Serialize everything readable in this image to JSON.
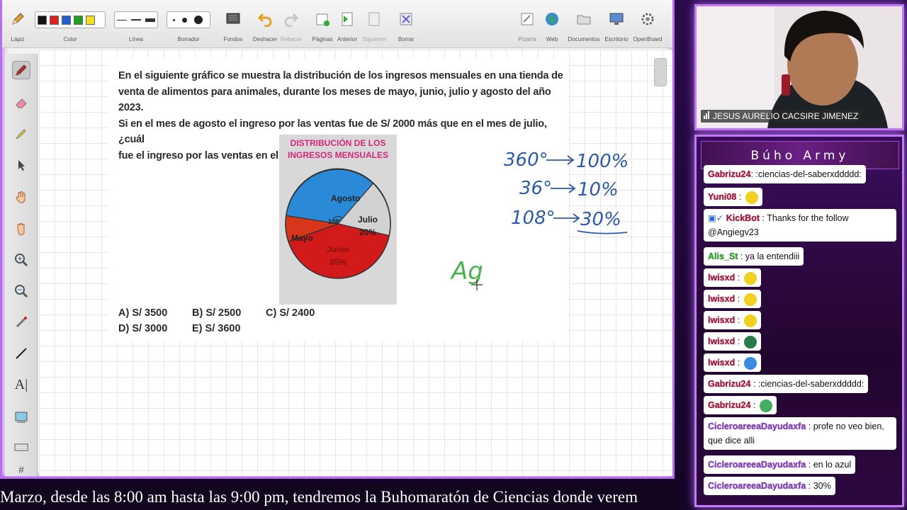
{
  "toolbar": {
    "pencil_label": "Lápiz",
    "color_label": "Color",
    "line_label": "Línea",
    "eraser_label": "Borrador",
    "backgrounds_label": "Fondos",
    "undo_label": "Deshacer",
    "redo_label": "Rehacer",
    "pages_label": "Páginas",
    "previous_label": "Anterior",
    "next_label": "Siguiente",
    "delete_label": "Borrar",
    "board_label": "Pizarra",
    "web_label": "Web",
    "documents_label": "Documentos",
    "desktop_label": "Escritorio",
    "openboard_label": "OpenBoard",
    "colors": [
      "#111111",
      "#e02020",
      "#1f5fd0",
      "#20a020",
      "#f0e020"
    ]
  },
  "left_tools": [
    "pen-icon",
    "marker-icon",
    "highlighter-icon",
    "pointer-icon",
    "hand-icon",
    "grab-icon",
    "zoom-in-icon",
    "zoom-out-icon",
    "laser-icon",
    "line-icon",
    "text-icon",
    "capture-icon",
    "keyboard-icon",
    "grid-icon"
  ],
  "problem": {
    "line1": "En el siguiente gráfico se muestra la distribución de los ingresos mensuales en una tienda de",
    "line2": "venta de alimentos para animales, durante los meses de mayo, junio, julio y agosto del año 2023.",
    "line3": "Si en el mes de agosto el ingreso por las ventas fue de S/ 2000 más que en el mes de julio, ¿cuál",
    "line4": "fue el ingreso por las ventas en el mes de mayo?",
    "answers": {
      "a": "A) S/ 3500",
      "b": "B) S/ 2500",
      "c": "C) S/ 2400",
      "d": "D) S/ 3000",
      "e": "E) S/ 3600"
    }
  },
  "pie": {
    "title_line1": "DISTRIBUCIÓN DE LOS",
    "title_line2": "INGRESOS MENSUALES",
    "agosto_label": "Agosto",
    "julio_label": "Julio",
    "julio_pct": "20%",
    "mayo_label": "Mayo",
    "junio_label": "Junio",
    "junio_pct": "35%",
    "angle_label": "108°",
    "colors": {
      "agosto": "#2a8ad8",
      "julio": "#d2d2d2",
      "junio": "#d21a1a",
      "mayo": "#d8361a"
    }
  },
  "handwriting": {
    "line1_a": "360°",
    "line1_b": "100%",
    "line2_a": "36°",
    "line2_b": "10%",
    "line3_a": "108°",
    "line3_b": "30%",
    "partial": "Ag"
  },
  "ticker": {
    "text": "Marzo, desde las 8:00 am hasta las 9:00 pm, tendremos la Buhomaratón de Ciencias donde verem"
  },
  "webcam": {
    "name": "JESUS AURELIO CACSIRE JIMENEZ"
  },
  "chat": {
    "title": "Búho Army",
    "messages": [
      {
        "user": "Gabrizu24",
        "color": "#b0143c",
        "text": ": :ciencias-del-saberxddddd:",
        "emote": ""
      },
      {
        "user": "Yuni08",
        "color": "#b0143c",
        "text": " : ",
        "emote": "#f0d020"
      },
      {
        "user": "KickBot",
        "color": "#b0143c",
        "text": " : Thanks for the follow",
        "text2": "@Angiegv23",
        "emote": ""
      },
      {
        "user": "Alis_St",
        "color": "#2aa82a",
        "text": " : ya la entendiii",
        "emote": ""
      },
      {
        "user": "lwisxd",
        "color": "#b0143c",
        "text": " : ",
        "emote": "#f0d020"
      },
      {
        "user": "lwisxd",
        "color": "#b0143c",
        "text": " : ",
        "emote": "#f0d020"
      },
      {
        "user": "lwisxd",
        "color": "#b0143c",
        "text": " : ",
        "emote": "#f0d020"
      },
      {
        "user": "lwisxd",
        "color": "#b0143c",
        "text": " : ",
        "emote": "#2a7a4a"
      },
      {
        "user": "lwisxd",
        "color": "#b0143c",
        "text": " : ",
        "emote": "#3a8ae0"
      },
      {
        "user": "Gabrizu24",
        "color": "#b0143c",
        "text": " : :ciencias-del-saberxddddd:",
        "emote": ""
      },
      {
        "user": "Gabrizu24",
        "color": "#b0143c",
        "text": " : ",
        "emote": "#40b060"
      },
      {
        "user": "CicleroareeaDayudaxfa",
        "color": "#8a3ac8",
        "text": " : profe no veo bien,",
        "text2": "que dice alli",
        "emote": ""
      },
      {
        "user": "CicleroareeaDayudaxfa",
        "color": "#8a3ac8",
        "text": " : en lo azul",
        "emote": ""
      },
      {
        "user": "CicleroareeaDayudaxfa",
        "color": "#8a3ac8",
        "text": " : 30%",
        "emote": ""
      }
    ]
  }
}
